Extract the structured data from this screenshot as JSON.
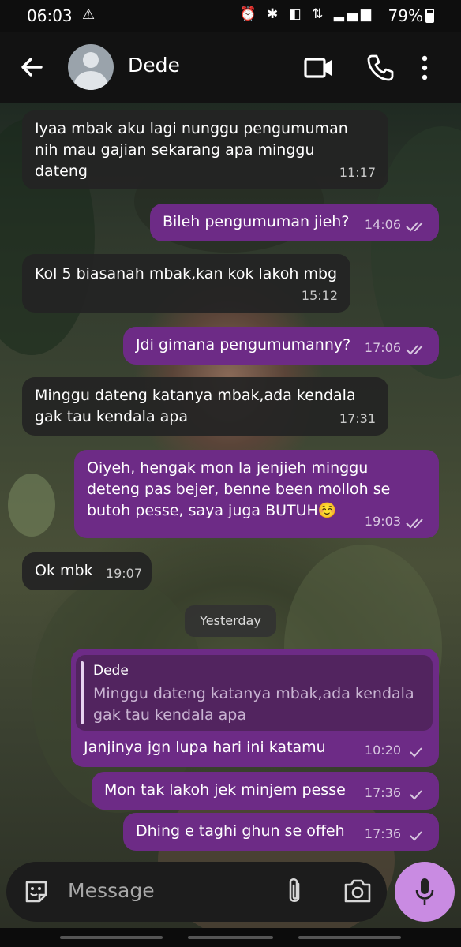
{
  "status": {
    "time": "06:03",
    "battery": "79%"
  },
  "appbar": {
    "contact_name": "Dede"
  },
  "messages": [
    {
      "lines": [
        "Iyaa mbak aku lagi nunggu pengumuman",
        "nih mau gajian sekarang apa minggu",
        "dateng"
      ],
      "time": "11:17"
    },
    {
      "lines": [
        "Bileh pengumuman jieh?"
      ],
      "time": "14:06"
    },
    {
      "lines": [
        "Kol 5 biasanah mbak,kan kok lakoh mbg"
      ],
      "time": "15:12"
    },
    {
      "lines": [
        "Jdi gimana pengumumanny?"
      ],
      "time": "17:06"
    },
    {
      "lines": [
        "Minggu dateng katanya mbak,ada kendala",
        "gak tau kendala apa"
      ],
      "time": "17:31"
    },
    {
      "lines": [
        "Oiyeh, hengak mon la jenjieh minggu",
        "deteng pas bejer, benne been molloh se",
        "butoh pesse, saya juga BUTUH☺️"
      ],
      "time": "19:03"
    },
    {
      "lines": [
        "Ok mbk"
      ],
      "time": "19:07"
    },
    {
      "lines": [
        "Janjinya jgn lupa hari ini katamu"
      ],
      "time": "10:20",
      "quote": {
        "author": "Dede",
        "lines": [
          "Minggu dateng katanya mbak,ada kendala",
          "gak tau kendala apa"
        ]
      }
    },
    {
      "lines": [
        "Mon tak lakoh jek minjem pesse"
      ],
      "time": "17:36"
    },
    {
      "lines": [
        "Dhing e taghi ghun se offeh"
      ],
      "time": "17:36"
    }
  ],
  "date_chip": "Yesterday",
  "composer": {
    "placeholder": "Message"
  },
  "colors": {
    "incoming": "#242424",
    "outgoing": "#6d2b86",
    "mic": "#c98be2"
  }
}
